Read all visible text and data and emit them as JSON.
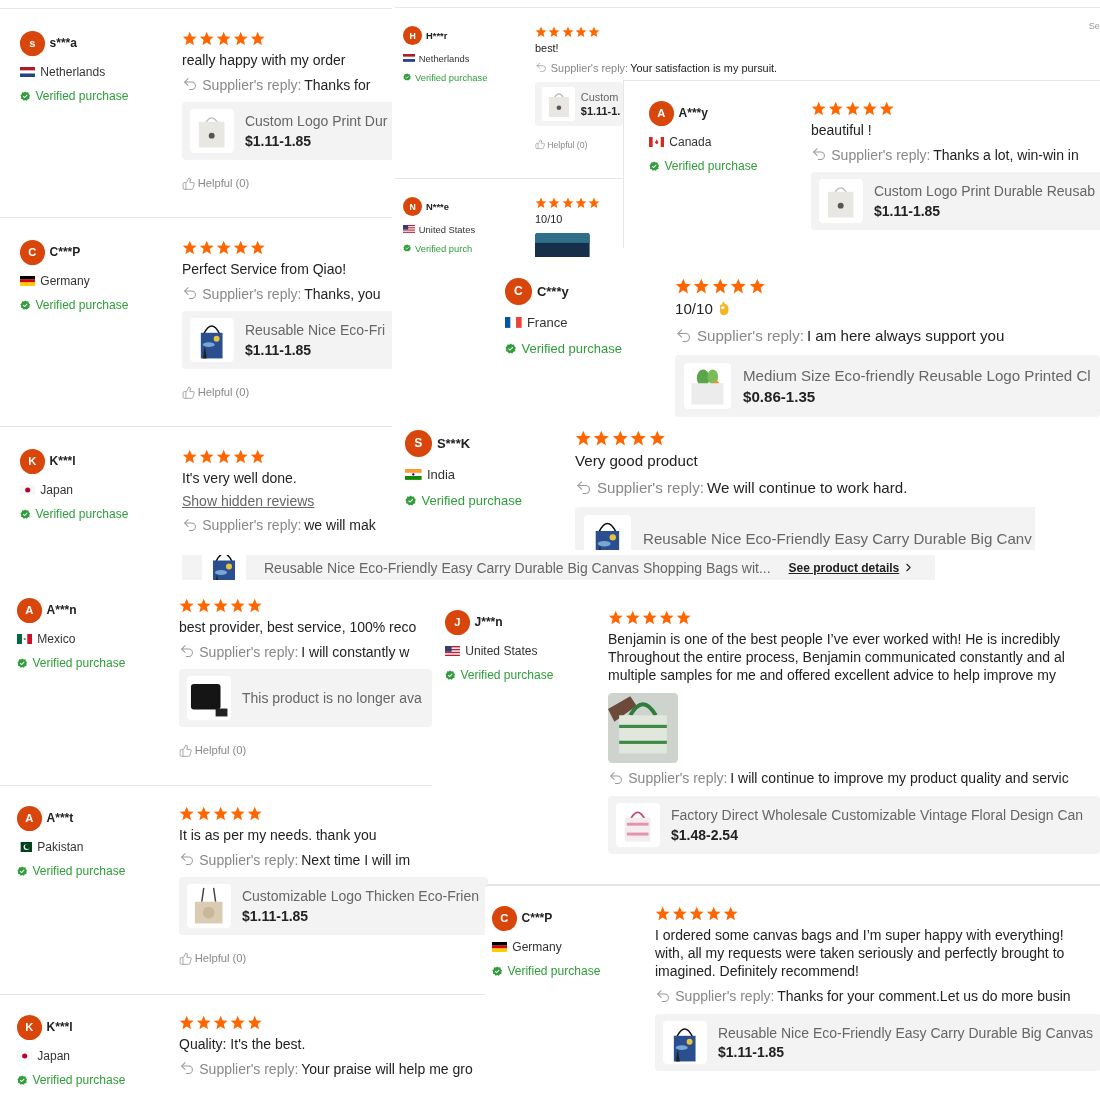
{
  "panels": [
    {
      "kind": "reviews",
      "reviews": [
        {
          "avatar_letter": "s",
          "name": "s***a",
          "flag": {
            "kind": "nl"
          },
          "country": "Netherlands",
          "verified": "Verified purchase",
          "stars": 5,
          "text": "really happy with my order",
          "reply_label": "Supplier's reply:",
          "reply": "Thanks for",
          "product": {
            "title": "Custom Logo Print Dur",
            "price": "$1.11-1.85"
          },
          "helpful": "Helpful (0)"
        },
        {
          "avatar_letter": "C",
          "name": "C***P",
          "flag": {
            "kind": "de"
          },
          "country": "Germany",
          "verified": "Verified purchase",
          "stars": 5,
          "text": "Perfect Service from Qiao!",
          "reply_label": "Supplier's reply:",
          "reply": "Thanks, you",
          "product": {
            "title": "Reusable Nice Eco-Fri",
            "price": "$1.11-1.85"
          },
          "helpful": "Helpful (0)"
        },
        {
          "avatar_letter": "K",
          "name": "K***l",
          "flag": {
            "kind": "jp"
          },
          "country": "Japan",
          "verified": "Verified purchase",
          "stars": 5,
          "text": "It's very well done.",
          "link": "Show hidden reviews",
          "reply_label": "Supplier's reply:",
          "reply": "we will mak"
        }
      ]
    },
    {
      "kind": "reviews",
      "corner_text": "Se",
      "reviews": [
        {
          "avatar_letter": "H",
          "name": "H***r",
          "flag": {
            "kind": "nl"
          },
          "country": "Netherlands",
          "verified": "Verified purchase",
          "stars": 5,
          "text": "best!",
          "reply_label": "Supplier's reply:",
          "reply": "Your satisfaction is my pursuit.",
          "product": {
            "title": "Custom",
            "price": "$1.11-1."
          },
          "helpful": "Helpful (0)"
        },
        {
          "avatar_letter": "N",
          "name": "N***e",
          "flag": {
            "kind": "us"
          },
          "country": "United States",
          "verified": "Verified purch",
          "stars": 5,
          "text": "10/10"
        }
      ]
    },
    {
      "kind": "reviews",
      "reviews": [
        {
          "avatar_letter": "A",
          "name": "A***y",
          "flag": {
            "kind": "ca"
          },
          "country": "Canada",
          "verified": "Verified purchase",
          "stars": 5,
          "text": "beautiful !",
          "reply_label": "Supplier's reply:",
          "reply": "Thanks a lot, win-win in",
          "product": {
            "title": "Custom Logo Print Durable Reusab",
            "price": "$1.11-1.85"
          }
        }
      ]
    },
    {
      "kind": "reviews",
      "reviews": [
        {
          "avatar_letter": "C",
          "name": "C***y",
          "flag": {
            "kind": "fr"
          },
          "country": "France",
          "verified": "Verified purchase",
          "stars": 5,
          "text": "10/10",
          "hand_emoji": true,
          "reply_label": "Supplier's reply:",
          "reply": "I am here always support you",
          "product": {
            "title": "Medium Size Eco-friendly Reusable Logo Printed Cl",
            "price": "$0.86-1.35"
          }
        }
      ]
    },
    {
      "kind": "reviews",
      "reviews": [
        {
          "avatar_letter": "S",
          "name": "S***K",
          "flag": {
            "kind": "in"
          },
          "country": "India",
          "verified": "Verified purchase",
          "stars": 5,
          "text": "Very good product",
          "reply_label": "Supplier's reply:",
          "reply": "We will continue to work hard.",
          "product": {
            "title": "Reusable Nice Eco-Friendly Easy Carry Durable Big Canv"
          }
        }
      ]
    },
    {
      "kind": "product_strip",
      "title": "Reusable Nice Eco-Friendly Easy Carry Durable Big Canvas Shopping Bags wit...",
      "link": "See product details"
    },
    {
      "kind": "reviews",
      "reviews": [
        {
          "avatar_letter": "J",
          "name": "J***n",
          "flag": {
            "kind": "us"
          },
          "country": "United States",
          "verified": "Verified purchase",
          "stars": 5,
          "text_lines": [
            "Benjamin is one of the best people I’ve ever worked with! He is incredibly",
            "Throughout the entire process, Benjamin communicated constantly and al",
            "multiple samples for me and offered excellent advice to help improve my"
          ],
          "reply_label": "Supplier's reply:",
          "reply": "I will continue to improve my product quality and servic",
          "product": {
            "title": "Factory Direct Wholesale Customizable Vintage Floral Design Can",
            "price": "$1.48-2.54"
          }
        }
      ]
    },
    {
      "kind": "reviews",
      "reviews": [
        {
          "avatar_letter": "A",
          "name": "A***n",
          "flag": {
            "kind": "mx"
          },
          "country": "Mexico",
          "verified": "Verified purchase",
          "stars": 5,
          "text": "best provider, best service, 100% reco",
          "reply_label": "Supplier's reply:",
          "reply": "I will constantly w",
          "product": {
            "note": "This product is no longer ava"
          },
          "helpful": "Helpful (0)"
        }
      ]
    },
    {
      "kind": "reviews",
      "reviews": [
        {
          "avatar_letter": "A",
          "name": "A***t",
          "flag": {
            "kind": "pk"
          },
          "country": "Pakistan",
          "verified": "Verified purchase",
          "stars": 5,
          "text": "It is as per my needs. thank you",
          "reply_label": "Supplier's reply:",
          "reply": "Next time I will im",
          "product": {
            "title": "Customizable Logo Thicken Eco-Frien",
            "price": "$1.11-1.85"
          },
          "helpful": "Helpful (0)"
        }
      ]
    },
    {
      "kind": "reviews",
      "reviews": [
        {
          "avatar_letter": "C",
          "name": "C***P",
          "flag": {
            "kind": "de"
          },
          "country": "Germany",
          "verified": "Verified purchase",
          "stars": 5,
          "text_lines": [
            "I ordered some canvas bags and I’m super happy with everything!",
            "with, all my requests were taken seriously and perfectly brought to",
            "imagined. Definitely recommend!"
          ],
          "reply_label": "Supplier's reply:",
          "reply": "Thanks for your comment.Let us do more busin",
          "product": {
            "title": "Reusable Nice Eco-Friendly Easy Carry Durable Big Canvas",
            "price": "$1.11-1.85"
          }
        }
      ]
    },
    {
      "kind": "reviews",
      "reviews": [
        {
          "avatar_letter": "K",
          "name": "K***l",
          "flag": {
            "kind": "jp"
          },
          "country": "Japan",
          "verified": "Verified purchase",
          "stars": 5,
          "text": "Quality: It's the best.",
          "reply_label": "Supplier's reply:",
          "reply": "Your praise will help me gro"
        }
      ]
    }
  ]
}
